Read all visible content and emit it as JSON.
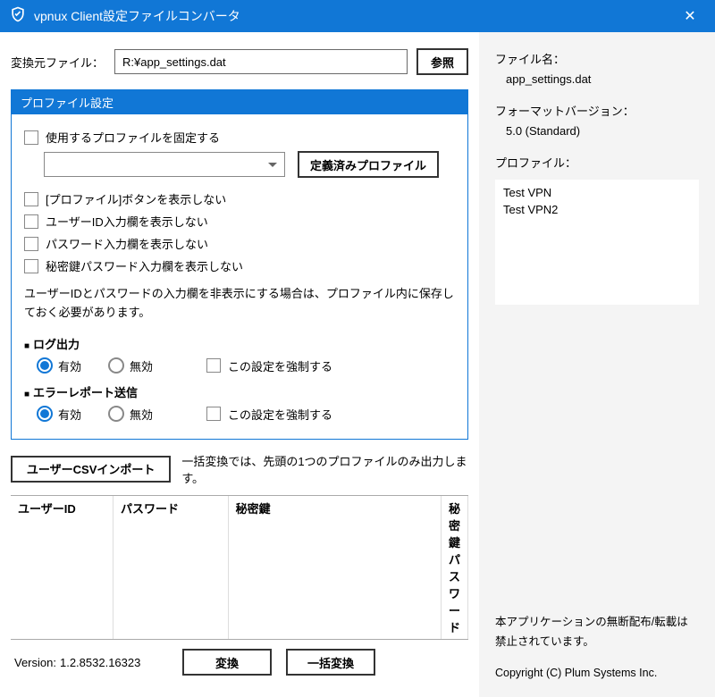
{
  "title": "vpnux Client設定ファイルコンバータ",
  "fileRow": {
    "label": "変換元ファイル：",
    "value": "R:¥app_settings.dat",
    "browse": "参照"
  },
  "profilePanel": {
    "header": "プロファイル設定",
    "fixProfile": "使用するプロファイルを固定する",
    "definedBtn": "定義済みプロファイル",
    "chkHideProfileBtn": "[プロファイル]ボタンを表示しない",
    "chkHideUserId": "ユーザーID入力欄を表示しない",
    "chkHidePassword": "パスワード入力欄を表示しない",
    "chkHideKeyPassword": "秘密鍵パスワード入力欄を表示しない",
    "desc": "ユーザーIDとパスワードの入力欄を非表示にする場合は、プロファイル内に保存しておく必要があります。",
    "logHeading": "ログ出力",
    "errHeading": "エラーレポート送信",
    "radioEnabled": "有効",
    "radioDisabled": "無効",
    "forceLabel": "この設定を強制する"
  },
  "importRow": {
    "btn": "ユーザーCSVインポート",
    "note": "一括変換では、先頭の1つのプロファイルのみ出力します。"
  },
  "table": {
    "h1": "ユーザーID",
    "h2": "パスワード",
    "h3": "秘密鍵",
    "h4": "秘密鍵パスワード"
  },
  "footer": {
    "versionLabel": "Version:",
    "version": "1.2.8532.16323",
    "convert": "変換",
    "batch": "一括変換"
  },
  "right": {
    "fileNameLabel": "ファイル名：",
    "fileName": "app_settings.dat",
    "formatLabel": "フォーマットバージョン：",
    "format": "5.0 (Standard)",
    "profilesLabel": "プロファイル：",
    "profiles": [
      "Test VPN",
      "Test VPN2"
    ],
    "disclaimer": "本アプリケーションの無断配布/転載は禁止されています。",
    "copyright": "Copyright (C) Plum Systems Inc."
  }
}
